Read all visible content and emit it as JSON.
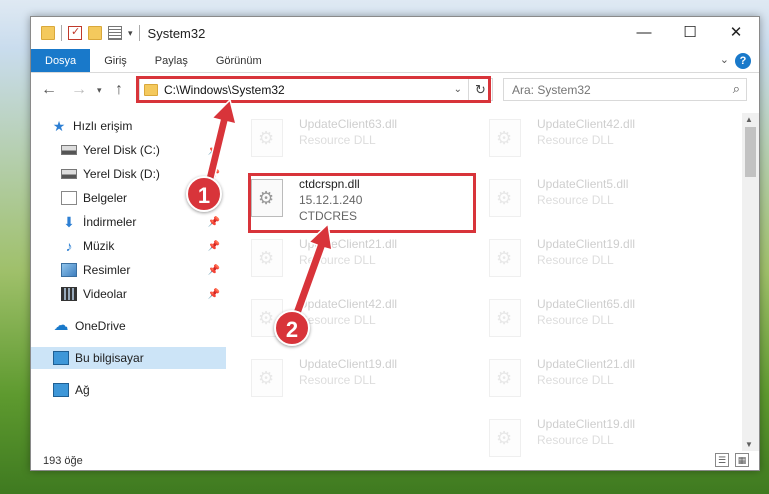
{
  "window": {
    "title": "System32",
    "controls": {
      "minimize": "—",
      "maximize": "☐",
      "close": "✕"
    }
  },
  "ribbon": {
    "tabs": [
      "Dosya",
      "Giriş",
      "Paylaş",
      "Görünüm"
    ],
    "help": "?"
  },
  "navigation": {
    "address_path": "C:\\Windows\\System32",
    "search_placeholder": "Ara: System32"
  },
  "sidebar": {
    "items": [
      {
        "label": "Hızlı erişim",
        "icon": "star-icon"
      },
      {
        "label": "Yerel Disk (C:)",
        "icon": "disk-icon"
      },
      {
        "label": "Yerel Disk (D:)",
        "icon": "disk-icon"
      },
      {
        "label": "Belgeler",
        "icon": "documents-icon"
      },
      {
        "label": "İndirmeler",
        "icon": "download-icon"
      },
      {
        "label": "Müzik",
        "icon": "music-icon"
      },
      {
        "label": "Resimler",
        "icon": "pictures-icon"
      },
      {
        "label": "Videolar",
        "icon": "videos-icon"
      },
      {
        "label": "OneDrive",
        "icon": "cloud-icon"
      },
      {
        "label": "Bu bilgisayar",
        "icon": "pc-icon",
        "selected": true
      },
      {
        "label": "Ağ",
        "icon": "network-icon"
      }
    ]
  },
  "files": {
    "highlighted": {
      "name": "ctdcrspn.dll",
      "version": "15.12.1.240",
      "company": "CTDCRES"
    },
    "left_column": [
      {
        "name": "UpdateClient63.dll",
        "desc": "Resource DLL"
      },
      {
        "name": "UpdateClient21.dll",
        "desc": "Resource DLL"
      },
      {
        "name": "UpdateClient42.dll",
        "desc": "Resource DLL"
      },
      {
        "name": "UpdateClient19.dll",
        "desc": "Resource DLL"
      }
    ],
    "right_column": [
      {
        "name": "UpdateClient42.dll",
        "desc": "Resource DLL"
      },
      {
        "name": "UpdateClient5.dll",
        "desc": "Resource DLL"
      },
      {
        "name": "UpdateClient19.dll",
        "desc": "Resource DLL"
      },
      {
        "name": "UpdateClient65.dll",
        "desc": "Resource DLL"
      },
      {
        "name": "UpdateClient21.dll",
        "desc": "Resource DLL"
      },
      {
        "name": "UpdateClient19.dll",
        "desc": "Resource DLL"
      }
    ]
  },
  "status": {
    "item_count": "193 öğe"
  },
  "annotations": {
    "step1": "1",
    "step2": "2",
    "color": "#d8343a"
  }
}
